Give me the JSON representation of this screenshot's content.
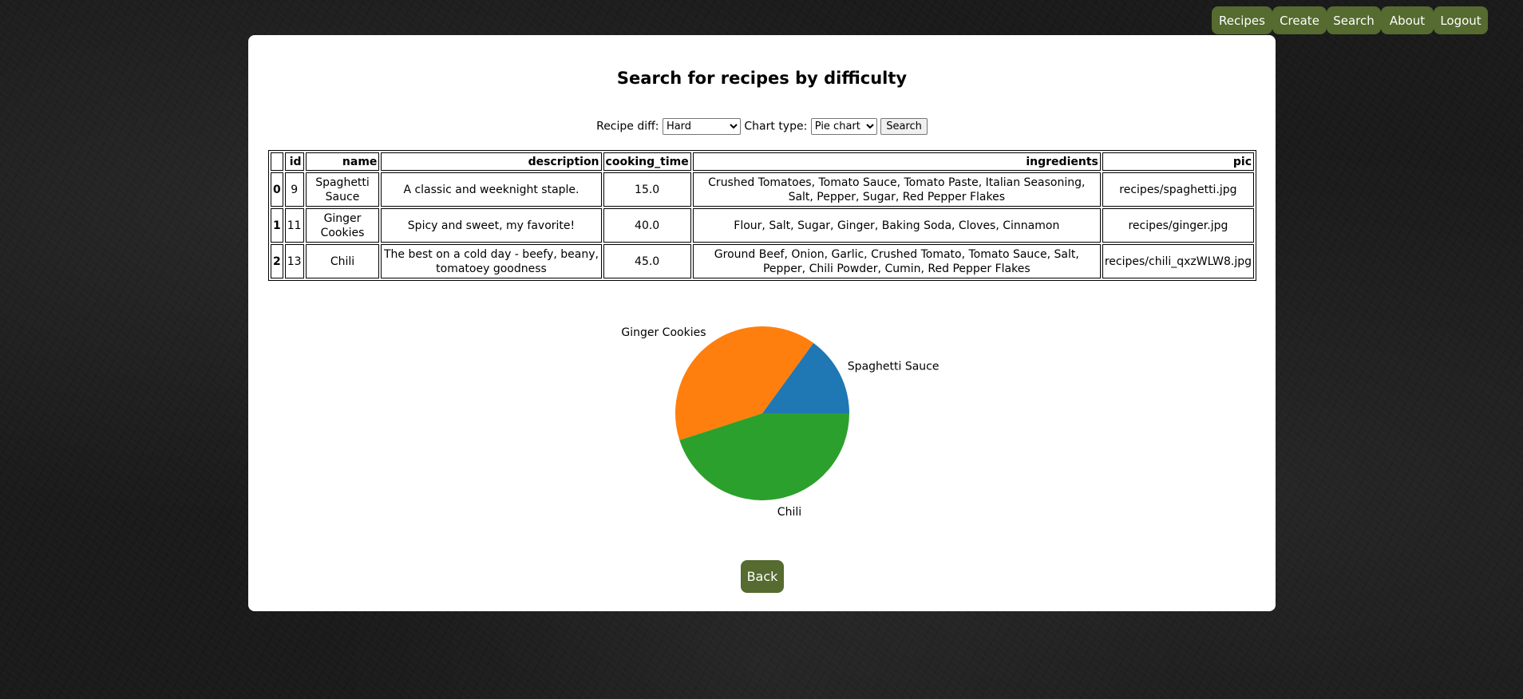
{
  "nav": {
    "items": [
      "Recipes",
      "Create",
      "Search",
      "About",
      "Logout"
    ]
  },
  "page": {
    "title": "Search for recipes by difficulty"
  },
  "form": {
    "diff_label": "Recipe diff:",
    "diff_value": "Hard",
    "chart_label": "Chart type:",
    "chart_value": "Pie chart",
    "search_label": "Search"
  },
  "table": {
    "headers": [
      "",
      "id",
      "name",
      "description",
      "cooking_time",
      "ingredients",
      "pic"
    ],
    "rows": [
      [
        "0",
        "9",
        "Spaghetti Sauce",
        "A classic and weeknight staple.",
        "15.0",
        "Crushed Tomatoes, Tomato Sauce, Tomato Paste, Italian Seasoning, Salt, Pepper, Sugar, Red Pepper Flakes",
        "recipes/spaghetti.jpg"
      ],
      [
        "1",
        "11",
        "Ginger Cookies",
        "Spicy and sweet, my favorite!",
        "40.0",
        "Flour, Salt, Sugar, Ginger, Baking Soda, Cloves, Cinnamon",
        "recipes/ginger.jpg"
      ],
      [
        "2",
        "13",
        "Chili",
        "The best on a cold day - beefy, beany, tomatoey goodness",
        "45.0",
        "Ground Beef, Onion, Garlic, Crushed Tomato, Tomato Sauce, Salt, Pepper, Chili Powder, Cumin, Red Pepper Flakes",
        "recipes/chili_qxzWLW8.jpg"
      ]
    ]
  },
  "chart_data": {
    "type": "pie",
    "categories": [
      "Spaghetti Sauce",
      "Ginger Cookies",
      "Chili"
    ],
    "values": [
      15.0,
      40.0,
      45.0
    ],
    "colors": [
      "#1f77b4",
      "#ff7f0e",
      "#2ca02c"
    ],
    "title": "",
    "legend": "none",
    "labels_outside": true
  },
  "back": {
    "label": "Back"
  }
}
